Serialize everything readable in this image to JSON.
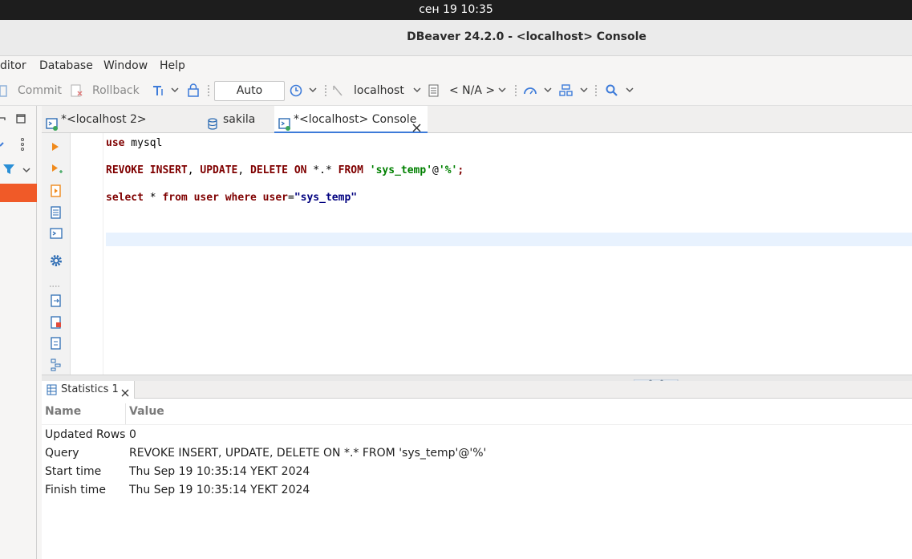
{
  "system": {
    "clock": "сен 19  10:35"
  },
  "window": {
    "title": "DBeaver 24.2.0 - <localhost> Console"
  },
  "menu": [
    "ditor",
    "Database",
    "Window",
    "Help"
  ],
  "toolbar": {
    "commit_label": "Commit",
    "rollback_label": "Rollback",
    "auto_commit_mode": "Auto",
    "connection": "localhost",
    "schema": "< N/A >"
  },
  "tabs": [
    {
      "label": "*<localhost 2> Console",
      "active": false
    },
    {
      "label": "sakila",
      "active": false
    },
    {
      "label": "*<localhost> Console",
      "active": true
    }
  ],
  "editor": {
    "line1": {
      "kw": "use",
      "rest": " mysql"
    },
    "line2": {
      "k1": "REVOKE INSERT",
      "p1": ", ",
      "k2": "UPDATE",
      "p2": ", ",
      "k3": "DELETE ON",
      "p3": " *.* ",
      "k4": "FROM",
      "p4": " ",
      "s1": "'sys_temp'",
      "p5": "@",
      "s2": "'%'",
      "p6": ";"
    },
    "line3": {
      "k1": "select",
      "p1": " * ",
      "k2": "from user where user",
      "p2": "=",
      "s1": "\"sys_temp\""
    }
  },
  "results": {
    "tab_label": "Statistics 1",
    "columns": [
      "Name",
      "Value"
    ],
    "rows": [
      {
        "name": "Updated Rows",
        "value": "0"
      },
      {
        "name": "Query",
        "value": "REVOKE INSERT, UPDATE, DELETE ON *.* FROM 'sys_temp'@'%'"
      },
      {
        "name": "Start time",
        "value": "Thu Sep 19 10:35:14 YEKT 2024"
      },
      {
        "name": "Finish time",
        "value": "Thu Sep 19 10:35:14 YEKT 2024"
      }
    ]
  },
  "colors": {
    "accent": "#3d7bd9",
    "selection": "#f05a28",
    "keyword": "#7f0000",
    "string": "#008000",
    "string2": "#00007f"
  }
}
